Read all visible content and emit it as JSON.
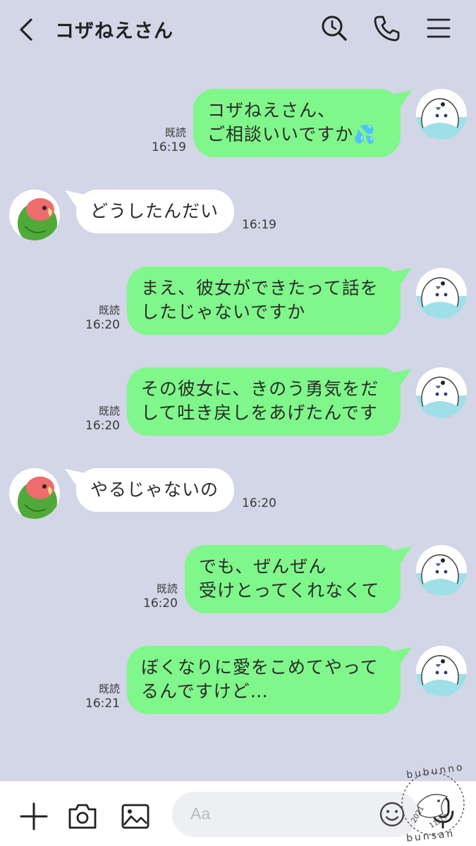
{
  "header": {
    "title": "コザねえさん"
  },
  "messages": [
    {
      "side": "right",
      "lines": [
        "コザねえさん、",
        "ご相談いいですか💦"
      ],
      "read": "既読",
      "time": "16:19"
    },
    {
      "side": "left",
      "lines": [
        "どうしたんだい"
      ],
      "time": "16:19"
    },
    {
      "side": "right",
      "lines": [
        "まえ、彼女ができたって話を",
        "したじゃないですか"
      ],
      "read": "既読",
      "time": "16:20"
    },
    {
      "side": "right",
      "lines": [
        "その彼女に、きのう勇気をだ",
        "して吐き戻しをあげたんです"
      ],
      "read": "既読",
      "time": "16:20"
    },
    {
      "side": "left",
      "lines": [
        "やるじゃないの"
      ],
      "time": "16:20"
    },
    {
      "side": "right",
      "lines": [
        "でも、ぜんぜん",
        "受けとってくれなくて"
      ],
      "read": "既読",
      "time": "16:20"
    },
    {
      "side": "right",
      "lines": [
        "ぼくなりに愛をこめてやって",
        "るんですけど…"
      ],
      "read": "既読",
      "time": "16:21"
    }
  ],
  "m0": {
    "text": "コザねえさん、\nご相談いいですか💦",
    "read": "既読",
    "time": "16:19"
  },
  "m1": {
    "text": "どうしたんだい",
    "time": "16:19"
  },
  "m2": {
    "text": "まえ、彼女ができたって話を\nしたじゃないですか",
    "read": "既読",
    "time": "16:20"
  },
  "m3": {
    "text": "その彼女に、きのう勇気をだ\nして吐き戻しをあげたんです",
    "read": "既読",
    "time": "16:20"
  },
  "m4": {
    "text": "やるじゃないの",
    "time": "16:20"
  },
  "m5": {
    "text": "でも、ぜんぜん\n受けとってくれなくて",
    "read": "既読",
    "time": "16:20"
  },
  "m6": {
    "text": "ぼくなりに愛をこめてやって\nるんですけど…",
    "read": "既読",
    "time": "16:21"
  },
  "input": {
    "placeholder": "Aa"
  },
  "watermark": {
    "top": "bubunno",
    "bottom": "bunsan",
    "year": "2021",
    "date": "11/17"
  },
  "icons": {
    "back": "chevron-left-icon",
    "search": "search-icon",
    "call": "phone-icon",
    "menu": "hamburger-menu-icon",
    "add": "plus-icon",
    "camera": "camera-icon",
    "image": "image-icon",
    "emoji": "smiley-icon",
    "mic": "microphone-icon"
  },
  "colors": {
    "background": "#d2d6e6",
    "sent_bubble": "#7ff78a",
    "received_bubble": "#ffffff",
    "footer": "#ffffff"
  }
}
